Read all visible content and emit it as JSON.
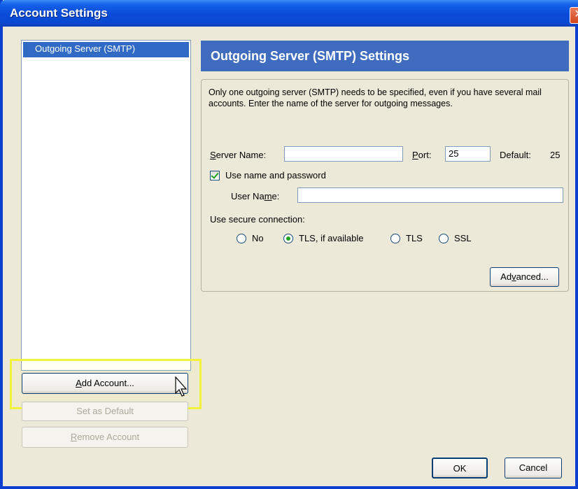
{
  "window": {
    "title": "Account Settings",
    "close_glyph": "✕"
  },
  "accounts": {
    "items": [
      "Outgoing Server (SMTP)"
    ]
  },
  "left_buttons": {
    "add_account": {
      "prefix": "",
      "mnemonic": "A",
      "rest": "dd Account..."
    },
    "set_default": "Set as Default",
    "remove_account": {
      "mnemonic": "R",
      "rest": "emove Account"
    }
  },
  "panel": {
    "header": "Outgoing Server (SMTP) Settings",
    "description": "Only one outgoing server (SMTP) needs to be specified, even if you have several mail accounts. Enter the name of the server for outgoing messages.",
    "server_name": {
      "mnemonic": "S",
      "rest": "erver Name:",
      "value": ""
    },
    "port": {
      "mnemonic": "P",
      "rest": "ort:",
      "value": "25"
    },
    "default": {
      "label": "Default:",
      "value": "25"
    },
    "use_password": {
      "label": "Use name and password",
      "checked": true
    },
    "user_name": {
      "before": "User Na",
      "mnemonic": "m",
      "after": "e:",
      "value": ""
    },
    "secure": {
      "label": "Use secure connection:",
      "options": [
        {
          "label": "No",
          "checked": false
        },
        {
          "label": "TLS, if available",
          "checked": true
        },
        {
          "label": "TLS",
          "checked": false
        },
        {
          "label": "SSL",
          "checked": false
        }
      ]
    },
    "advanced": {
      "before": "Ad",
      "mnemonic": "v",
      "after": "anced..."
    }
  },
  "footer": {
    "ok": "OK",
    "cancel": "Cancel"
  },
  "colors": {
    "titlebar": "#0a4ad8",
    "panel_header": "#3f6cbf",
    "selection": "#316ac5",
    "highlight": "#f2f23a"
  }
}
